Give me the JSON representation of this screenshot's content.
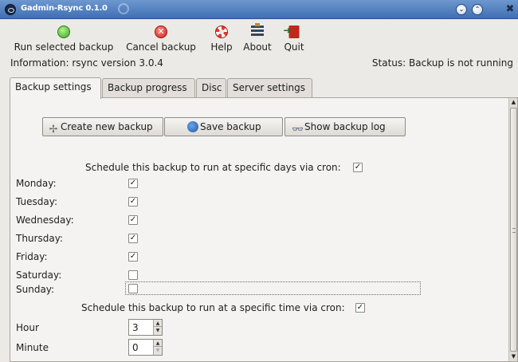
{
  "window": {
    "title": "Gadmin-Rsync 0.1.0",
    "buttons": {
      "minimize": "⌄",
      "maximize": "⌃",
      "close": "✖"
    }
  },
  "toolbar": {
    "run": "Run selected backup",
    "cancel": "Cancel backup",
    "help": "Help",
    "about": "About",
    "quit": "Quit"
  },
  "info": {
    "left": "Information: rsync  version 3.0.4",
    "right": "Status: Backup is not running"
  },
  "tabs": [
    "Backup settings",
    "Backup progress",
    "Disc",
    "Server settings"
  ],
  "actions": {
    "create": "Create new backup",
    "save": "Save backup",
    "log": "Show backup log"
  },
  "schedule": {
    "days_label": "Schedule this backup to run at specific days via cron:",
    "days_enabled": true,
    "days": [
      {
        "label": "Monday:",
        "checked": true
      },
      {
        "label": "Tuesday:",
        "checked": true
      },
      {
        "label": "Wednesday:",
        "checked": true
      },
      {
        "label": "Thursday:",
        "checked": true
      },
      {
        "label": "Friday:",
        "checked": true
      },
      {
        "label": "Saturday:",
        "checked": false
      },
      {
        "label": "Sunday:",
        "checked": false
      }
    ],
    "time_label": "Schedule this backup to run at a specific time via cron:",
    "time_enabled": true,
    "hour_label": "Hour",
    "hour_value": "3",
    "minute_label": "Minute",
    "minute_value": "0"
  },
  "icons": {
    "run": "green-circle-icon",
    "cancel": "red-x-icon",
    "help": "lifebuoy-icon",
    "about": "stack-icon",
    "quit": "exit-door-icon"
  },
  "colors": {
    "titlebar": "#4f7fc0",
    "run": "#3aa623",
    "cancel": "#d0211a"
  }
}
